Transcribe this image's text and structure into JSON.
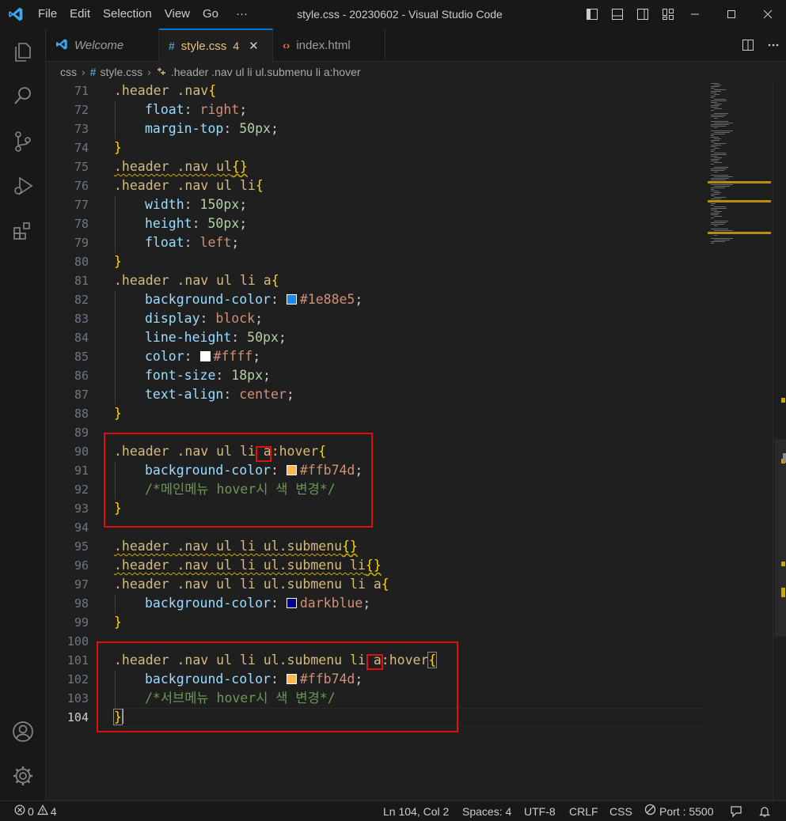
{
  "titlebar": {
    "menu": [
      "File",
      "Edit",
      "Selection",
      "View",
      "Go",
      "···"
    ],
    "title": "style.css - 20230602 - Visual Studio Code"
  },
  "tabs": [
    {
      "label": "Welcome",
      "icon": "vscode-logo-icon"
    },
    {
      "label": "style.css",
      "icon": "css-hash-icon",
      "badge": "4",
      "active": true
    },
    {
      "label": "index.html",
      "icon": "html-brackets-icon"
    }
  ],
  "breadcrumb": {
    "folder": "css",
    "file": "style.css",
    "symbol": ".header .nav ul li ul.submenu li a:hover"
  },
  "editor": {
    "current_line": "104",
    "lines": [
      {
        "n": "71"
      },
      {
        "n": "72"
      },
      {
        "n": "73"
      },
      {
        "n": "74"
      },
      {
        "n": "75"
      },
      {
        "n": "76"
      },
      {
        "n": "77"
      },
      {
        "n": "78"
      },
      {
        "n": "79"
      },
      {
        "n": "80"
      },
      {
        "n": "81"
      },
      {
        "n": "82"
      },
      {
        "n": "83"
      },
      {
        "n": "84"
      },
      {
        "n": "85"
      },
      {
        "n": "86"
      },
      {
        "n": "87"
      },
      {
        "n": "88"
      },
      {
        "n": "89"
      },
      {
        "n": "90"
      },
      {
        "n": "91"
      },
      {
        "n": "92"
      },
      {
        "n": "93"
      },
      {
        "n": "94"
      },
      {
        "n": "95"
      },
      {
        "n": "96"
      },
      {
        "n": "97"
      },
      {
        "n": "98"
      },
      {
        "n": "99"
      },
      {
        "n": "100"
      },
      {
        "n": "101"
      },
      {
        "n": "102"
      },
      {
        "n": "103"
      },
      {
        "n": "104"
      }
    ],
    "code": {
      "l71_sel": ".header .nav",
      "l72_prop": "float",
      "l72_val": "right",
      "l73_prop": "margin-top",
      "l73_val": "50px",
      "l75_sel": ".header .nav ul",
      "l76_sel": ".header .nav ul li",
      "l77_prop": "width",
      "l77_val": "150px",
      "l78_prop": "height",
      "l78_val": "50px",
      "l79_prop": "float",
      "l79_val": "left",
      "l81_sel": ".header .nav ul li a",
      "l82_prop": "background-color",
      "l82_val": "#1e88e5",
      "l83_prop": "display",
      "l83_val": "block",
      "l84_prop": "line-height",
      "l84_val": "50px",
      "l85_prop": "color",
      "l85_val": "#ffff",
      "l86_prop": "font-size",
      "l86_val": "18px",
      "l87_prop": "text-align",
      "l87_val": "center",
      "l90_sel_a": ".header .nav ul li ",
      "l90_sel_b": "a",
      "l90_sel_c": ":hover",
      "l91_prop": "background-color",
      "l91_val": "#ffb74d",
      "l92_comment": "/*메인메뉴 hover시 색 변경*/",
      "l95_sel": ".header .nav ul li ul.submenu",
      "l96_sel": ".header .nav ul li ul.submenu li",
      "l97_sel": ".header .nav ul li ul.submenu li a",
      "l98_prop": "background-color",
      "l98_val": "darkblue",
      "l101_sel_a": ".header .nav ul li ul.submenu li ",
      "l101_sel_b": "a",
      "l101_sel_c": ":hover",
      "l102_prop": "background-color",
      "l102_val": "#ffb74d",
      "l103_comment": "/*서브메뉴 hover시 색 변경*/"
    },
    "swatch_colors": {
      "blue": "#1e88e5",
      "white": "#ffffff",
      "orange": "#ffb74d",
      "darkblue": "#00008b"
    }
  },
  "statusbar": {
    "errors": "0",
    "warnings": "4",
    "position": "Ln 104, Col 2",
    "spaces": "Spaces: 4",
    "encoding": "UTF-8",
    "eol": "CRLF",
    "language": "CSS",
    "port": "Port : 5500"
  },
  "colors": {
    "accent": "#0078d4",
    "annotation": "#e10e0e",
    "warning": "#cca700"
  }
}
